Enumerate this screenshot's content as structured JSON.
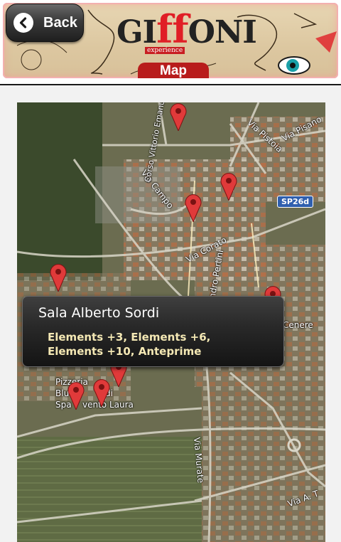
{
  "header": {
    "back_label": "Back",
    "logo_brand": "GIFFONI",
    "logo_sub": "experience",
    "page_title": "Map"
  },
  "map": {
    "shield_label": "SP26d",
    "street_labels": [
      "Via Pisano",
      "Via Pistoia",
      "Via Campo",
      "Corso Vittorio Emanuele",
      "Via Corato",
      "andro Pertini",
      "Cenere",
      "Via Murate",
      "Via A. T",
      "Pizzeria",
      "Blu",
      "di",
      "Spa",
      "vento Laura"
    ],
    "popup": {
      "title": "Sala Alberto Sordi",
      "lines": [
        "Elements +3, Elements +6,",
        "Elements +10, Anteprime"
      ]
    }
  },
  "colors": {
    "pin": "#e03a3a",
    "back_button": "#2c2c2c",
    "title_tab": "#b81c1c",
    "popup_text": "#f4e8b4"
  }
}
